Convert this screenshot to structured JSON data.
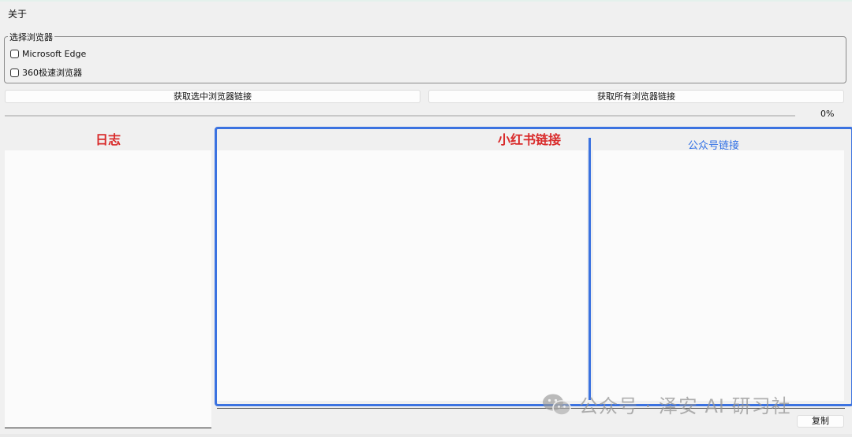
{
  "menu": {
    "about": "关于"
  },
  "browser_select": {
    "title": "选择浏览器",
    "options": [
      {
        "label": "Microsoft Edge",
        "checked": false
      },
      {
        "label": "360极速浏览器",
        "checked": false
      }
    ]
  },
  "buttons": {
    "get_selected": "获取选中浏览器链接",
    "get_all": "获取所有浏览器链接",
    "copy": "复制"
  },
  "progress": {
    "value": 0,
    "label": "0%"
  },
  "sections": {
    "log": "日志",
    "xiaohongshu": "小红书链接",
    "gongzhonghao": "公众号链接"
  },
  "watermark": {
    "text": "公众号 · 泽安 AI 研习社"
  },
  "colors": {
    "highlight": "#3b72e0",
    "red_title": "#d92b2b",
    "blue_title": "#2f6fe5"
  }
}
